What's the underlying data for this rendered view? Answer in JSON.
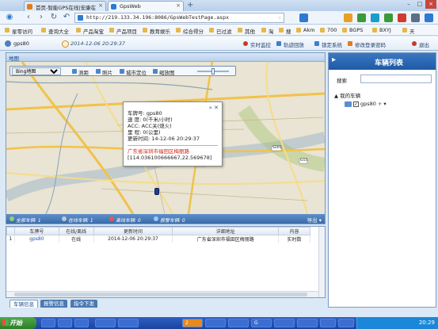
{
  "browser": {
    "tabs": [
      {
        "label": "首页-智能GPS在线|安康在",
        "active": false
      },
      {
        "label": "GpsWeb",
        "active": true
      }
    ],
    "url": "http://219.133.34.196:8086/GpsWebTestPage.aspx",
    "bookmarks": [
      "星零访问",
      "查询大全",
      "产品淘宝",
      "产品项目",
      "教育娱乐",
      "综合得分",
      "已过滤",
      "其他",
      "淘",
      "搜",
      "Akm",
      "700",
      "BGPS",
      "BXYJ",
      "天"
    ]
  },
  "header": {
    "user": "gps80",
    "datetime": "2014-12-06 20:29:37",
    "links": [
      "实时监控",
      "轨迹回放",
      "锁定系统",
      "修改登录密码",
      "退出"
    ]
  },
  "map_panel": {
    "title": "地图",
    "map_type": "Bing地图",
    "tools": [
      "测距",
      "照片",
      "城市定位",
      "缩放图"
    ],
    "zoom_level_fraction": 0.5,
    "labels": [
      "G205",
      "G15",
      "S205"
    ],
    "popup": {
      "rows": [
        "车牌号: gps80",
        "速 度: 0(千米/小时)",
        "ACC: ACC关(熄火)",
        "里 程: 0(公里)",
        "更新时间: 14-12-06 20:29:37"
      ],
      "address": "广东省深圳市福田区梅丽路",
      "coord": "[114.036100666667,22.569678]"
    },
    "status": {
      "all": "全部车辆: 1",
      "online": "在线车辆: 1",
      "offline": "离线车辆: 0",
      "alarm": "报警车辆: 0",
      "export": "导出"
    }
  },
  "table": {
    "headers": [
      "",
      "车牌号",
      "在线/离线",
      "更新时间",
      "详细地址",
      "内容"
    ],
    "rows": [
      [
        "1",
        "gps80",
        "在线",
        "2014-12-06 20:29:37",
        "广东省深圳市福田区梅丽路",
        "实时数"
      ]
    ]
  },
  "bottom_tabs": [
    "车辆信息",
    "报警信息",
    "指令下发"
  ],
  "right_panel": {
    "title": "车辆列表",
    "search_label": "搜索",
    "tree_root": "我的车辆",
    "vehicle": "gps80"
  },
  "taskbar": {
    "start": "开始",
    "items": [
      "",
      "",
      "",
      "",
      "",
      "2",
      "",
      "",
      "G",
      "",
      "",
      "",
      ""
    ],
    "time": "20:29"
  },
  "colors": {
    "accent": "#1e5aa5",
    "status_bar": "#3a6cab",
    "address_red": "#d1261a"
  }
}
